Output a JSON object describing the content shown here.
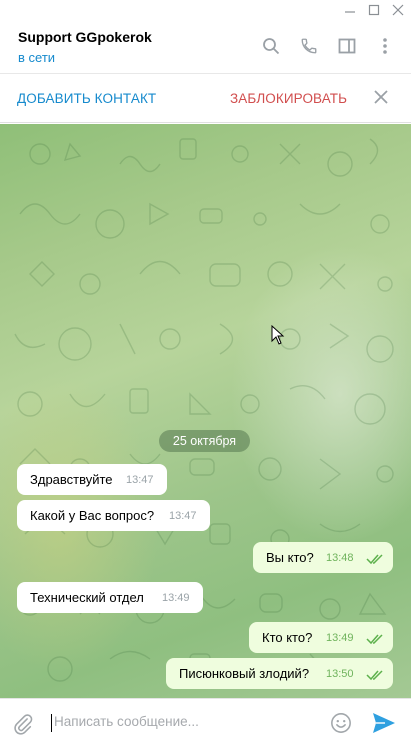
{
  "window": {
    "controls": [
      "minimize-icon",
      "maximize-icon",
      "close-icon"
    ]
  },
  "header": {
    "title": "Support GGpokerok",
    "status": "в сети",
    "icons": [
      "search-icon",
      "phone-icon",
      "sidebar-icon",
      "more-vertical-icon"
    ]
  },
  "actionbar": {
    "add_contact": "ДОБАВИТЬ КОНТАКТ",
    "block": "ЗАБЛОКИРОВАТЬ"
  },
  "chat": {
    "date": "25 октября",
    "messages": [
      {
        "dir": "in",
        "text": "Здравствуйте",
        "time": "13:47"
      },
      {
        "dir": "in",
        "text": "Какой у Вас вопрос?",
        "time": "13:47"
      },
      {
        "dir": "out",
        "text": "Вы кто?",
        "time": "13:48",
        "read": true
      },
      {
        "dir": "in",
        "text": "Технический отдел",
        "time": "13:49"
      },
      {
        "dir": "out",
        "text": "Кто кто?",
        "time": "13:49",
        "read": true
      },
      {
        "dir": "out",
        "text": "Писюнковый злодий?",
        "time": "13:50",
        "read": true
      }
    ]
  },
  "composer": {
    "placeholder": "Написать сообщение..."
  },
  "colors": {
    "accent": "#168acd",
    "danger": "#d14e4e",
    "outgoing_bubble": "#effdde",
    "read_check": "#5db14c"
  }
}
